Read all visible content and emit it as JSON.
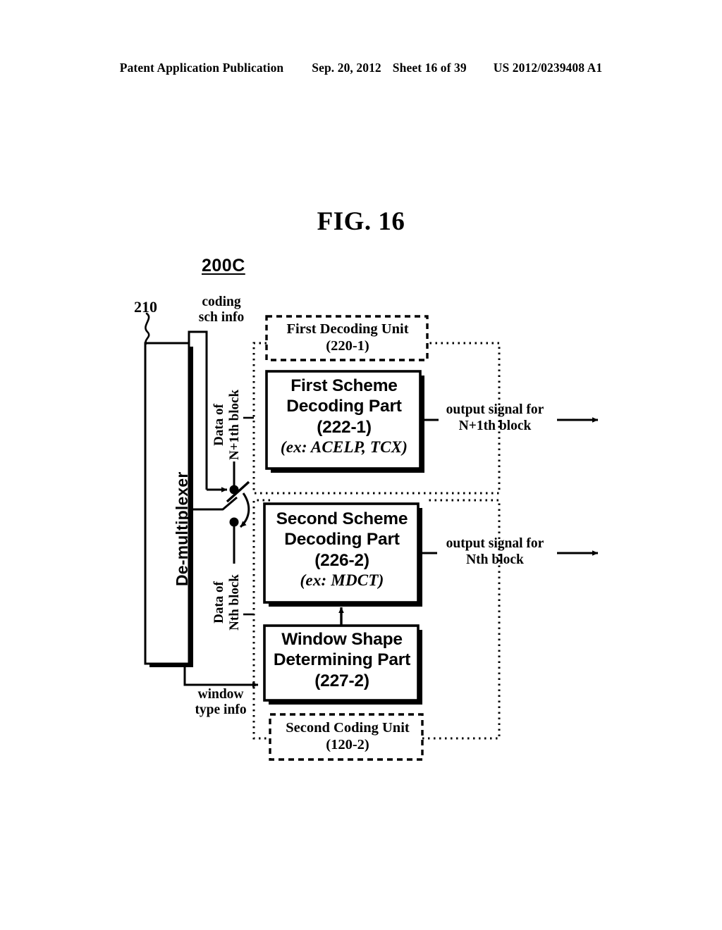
{
  "header": {
    "publication": "Patent Application Publication",
    "date": "Sep. 20, 2012",
    "sheet": "Sheet 16 of 39",
    "patent_number": "US 2012/0239408 A1"
  },
  "figure": {
    "title": "FIG. 16",
    "system_label": "200C"
  },
  "demultiplexer": {
    "ref": "210",
    "label": "De-multiplexer"
  },
  "signals": {
    "coding_scheme_info": "coding\nsch info",
    "coding_scheme_info_line1": "coding",
    "coding_scheme_info_line2": "sch info",
    "window_type_info_line1": "window",
    "window_type_info_line2": "type info",
    "data_n_plus_1_line1": "Data of",
    "data_n_plus_1_line2": "N+1th block",
    "data_n_line1": "Data of",
    "data_n_line2": "Nth block",
    "output_1_line1": "output signal for",
    "output_1_line2": "N+1th block",
    "output_2_line1": "output signal for",
    "output_2_line2": "Nth block"
  },
  "units": {
    "first_decoding_unit": {
      "name": "First Decoding Unit",
      "ref": "(220-1)"
    },
    "second_coding_unit": {
      "name": "Second Coding Unit",
      "ref": "(120-2)"
    }
  },
  "blocks": {
    "first_scheme": {
      "line1": "First Scheme",
      "line2": "Decoding Part",
      "ref": "(222-1)",
      "example": "(ex: ACELP, TCX)"
    },
    "second_scheme": {
      "line1": "Second Scheme",
      "line2": "Decoding Part",
      "ref": "(226-2)",
      "example": "(ex: MDCT)"
    },
    "window_shape": {
      "line1": "Window Shape",
      "line2": "Determining Part",
      "ref": "(227-2)"
    }
  },
  "colors": {
    "ink": "#000000",
    "paper": "#ffffff"
  }
}
